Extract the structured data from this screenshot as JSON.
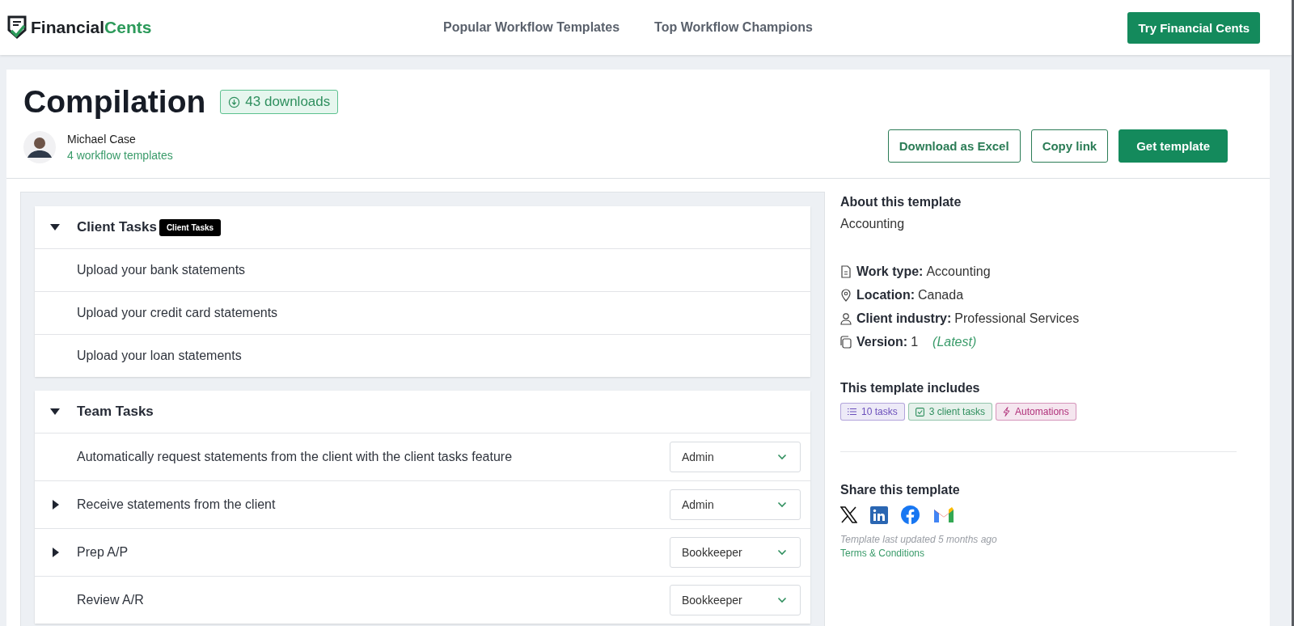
{
  "header": {
    "logo": {
      "part_1": "Financial",
      "part_2": "Cents"
    },
    "nav": [
      "Popular Workflow Templates",
      "Top Workflow Champions"
    ],
    "cta": "Try Financial Cents"
  },
  "template": {
    "title": "Compilation",
    "downloads": "43 downloads",
    "author": {
      "name": "Michael Case",
      "templates": "4 workflow templates"
    },
    "actions": [
      {
        "label": "Download as Excel",
        "kind": "outline"
      },
      {
        "label": "Copy link",
        "kind": "outline"
      },
      {
        "label": "Get template",
        "kind": "primary"
      }
    ]
  },
  "groups": [
    {
      "title": "Client Tasks",
      "expanded": true,
      "tooltip": "Client Tasks",
      "tasks": [
        {
          "label": "Upload your bank statements",
          "kind": "plain"
        },
        {
          "label": "Upload your credit card statements",
          "kind": "plain"
        },
        {
          "label": "Upload your loan statements",
          "kind": "plain"
        }
      ]
    },
    {
      "title": "Team Tasks",
      "expanded": true,
      "tasks": [
        {
          "label": "Automatically request statements from the client with the client tasks feature",
          "kind": "plain",
          "role": "Admin"
        },
        {
          "label": "Receive statements from the client",
          "kind": "collapsible",
          "expanded": false,
          "role": "Admin"
        },
        {
          "label": "Prep A/P",
          "kind": "collapsible",
          "expanded": false,
          "role": "Bookkeeper"
        },
        {
          "label": "Review A/R",
          "kind": "plain",
          "role": "Bookkeeper"
        }
      ]
    }
  ],
  "about": {
    "heading": "About this template",
    "category": "Accounting",
    "details": [
      {
        "kind": "document",
        "label": "Work type:",
        "value": "Accounting"
      },
      {
        "kind": "location",
        "label": "Location:",
        "value": "Canada"
      },
      {
        "kind": "person",
        "label": "Client industry:",
        "value": "Professional Services"
      },
      {
        "kind": "copy",
        "label": "Version:",
        "value": "1",
        "note": "(Latest)"
      }
    ],
    "includes_heading": "This template includes",
    "tags": [
      {
        "kind": "list",
        "label": "10 tasks",
        "color": "#6b4fbb"
      },
      {
        "kind": "check",
        "label": "3 client tasks",
        "color": "#2f8f5e"
      },
      {
        "kind": "bolt",
        "label": "Automations",
        "color": "#b0307a"
      }
    ],
    "share_heading": "Share this template",
    "share": [
      {
        "kind": "x"
      },
      {
        "kind": "linkedin"
      },
      {
        "kind": "facebook"
      },
      {
        "kind": "gmail"
      }
    ],
    "updated": "Template last updated 5 months ago",
    "terms": "Terms & Conditions"
  }
}
